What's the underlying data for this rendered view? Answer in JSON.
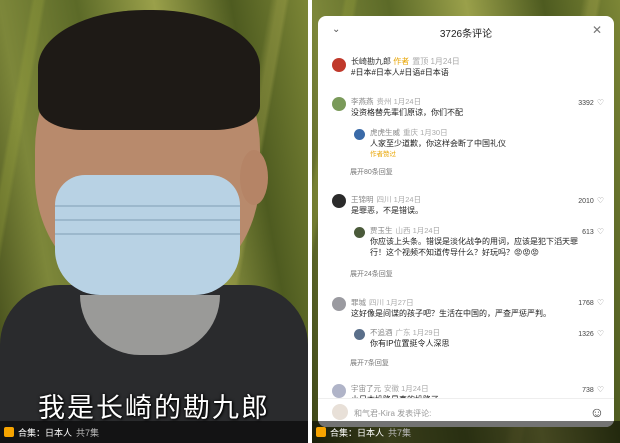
{
  "left_video": {
    "subtitle": "我是长崎的勘九郎",
    "footer": {
      "label": "合集：日本人",
      "count": "共7集"
    }
  },
  "right_video": {
    "footer": {
      "label": "合集：日本人",
      "count": "共7集"
    }
  },
  "comments_panel": {
    "title": "3726条评论",
    "input_placeholder": "和气君-Kira 发表评论:",
    "author": {
      "name": "长崎勘九郎",
      "tag": "作者",
      "meta": "置顶 1月24日",
      "text": "#日本#日本人#日语#日本语"
    },
    "comments": [
      {
        "name": "李燕燕",
        "meta": "贵州 1月24日",
        "text": "没资格替先辈们原谅，你们不配",
        "likes": "3392"
      },
      {
        "name": "虎虎生威",
        "meta": "重庆 1月30日",
        "text": "人家至少道歉，你这样会断了中国礼仪",
        "sub": "作者赞过",
        "reply": true
      },
      {
        "expand": "展开80条回复"
      },
      {
        "name": "王锦明",
        "meta": "四川 1月24日",
        "text": "是罪恶，不是错误。",
        "likes": "2010"
      },
      {
        "name": "贾玉生",
        "meta": "山西 1月24日",
        "text": "你应该上头条。错误是淡化战争的用词，应该是犯下滔天罪",
        "text2": "行！这个视频不知道传导什么？好玩吗？😡😡😡",
        "likes": "613",
        "reply": true
      },
      {
        "expand": "展开24条回复"
      },
      {
        "name": "罪城",
        "meta": "四川 1月27日",
        "text": "这好像是间谍的孩子吧？生活在中国的，严查严惩严判。",
        "likes": "1768"
      },
      {
        "name": "不追酒",
        "meta": "广东 1月29日",
        "text": "你有IP位置挺令人深思",
        "likes": "1326",
        "reply": true
      },
      {
        "expand": "展开7条回复"
      },
      {
        "name": "宇宙了元",
        "meta": "安徽 1月24日",
        "text": "小日本投降是真的投降了",
        "likes": "738"
      }
    ]
  },
  "colors": {
    "accent": "#e8a400",
    "panel_bg": "#ffffff"
  },
  "icons": [
    "chevron-down-icon",
    "close-icon",
    "heart-icon",
    "emoji-icon",
    "collection-icon"
  ]
}
